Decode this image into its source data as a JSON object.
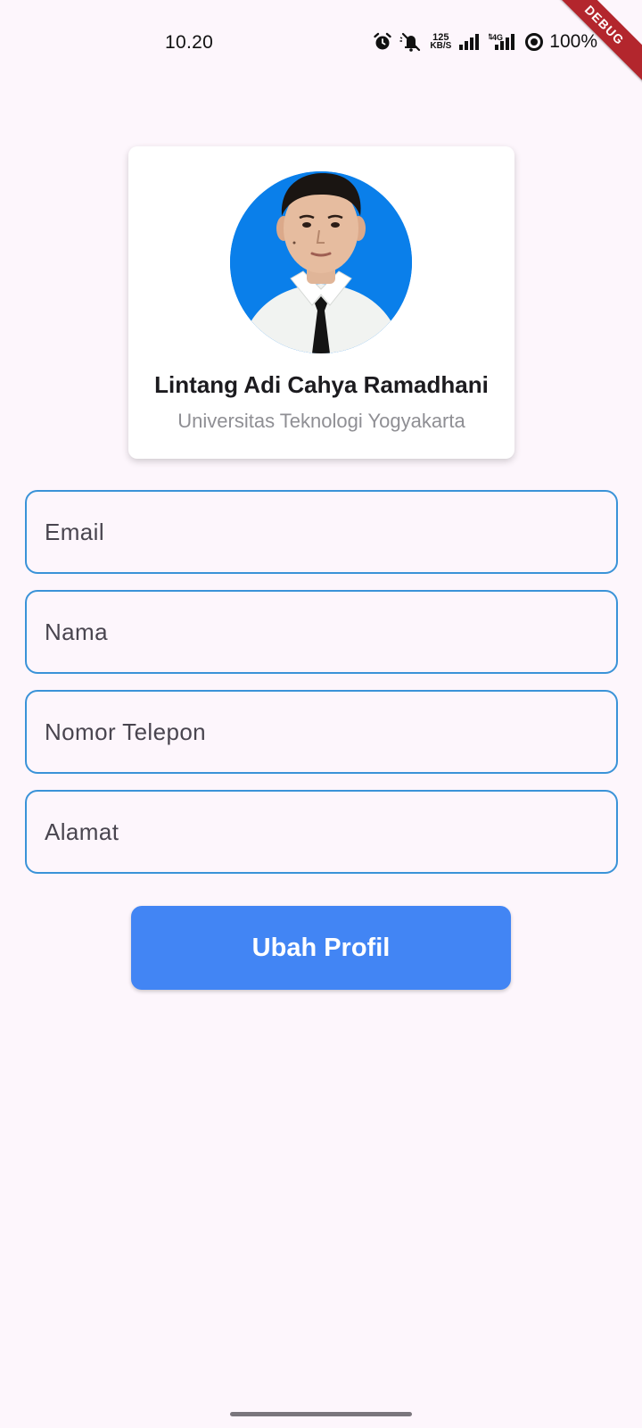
{
  "status_bar": {
    "time": "10.20",
    "net_speed_value": "125",
    "net_speed_unit": "KB/S",
    "network_type": "4G",
    "battery": "100%",
    "icons": [
      "alarm-icon",
      "mute-icon",
      "signal-icon",
      "signal-4g-icon",
      "data-saver-icon"
    ]
  },
  "debug_banner": "DEBUG",
  "profile": {
    "name": "Lintang Adi Cahya Ramadhani",
    "university": "Universitas Teknologi Yogyakarta",
    "avatar_background": "#0a7fea"
  },
  "form": {
    "email_placeholder": "Email",
    "name_placeholder": "Nama",
    "phone_placeholder": "Nomor Telepon",
    "address_placeholder": "Alamat",
    "submit_label": "Ubah Profil"
  },
  "colors": {
    "accent": "#4285f4",
    "field_border": "#3a93d8",
    "background": "#fdf6fc",
    "debug": "#b3262d"
  }
}
